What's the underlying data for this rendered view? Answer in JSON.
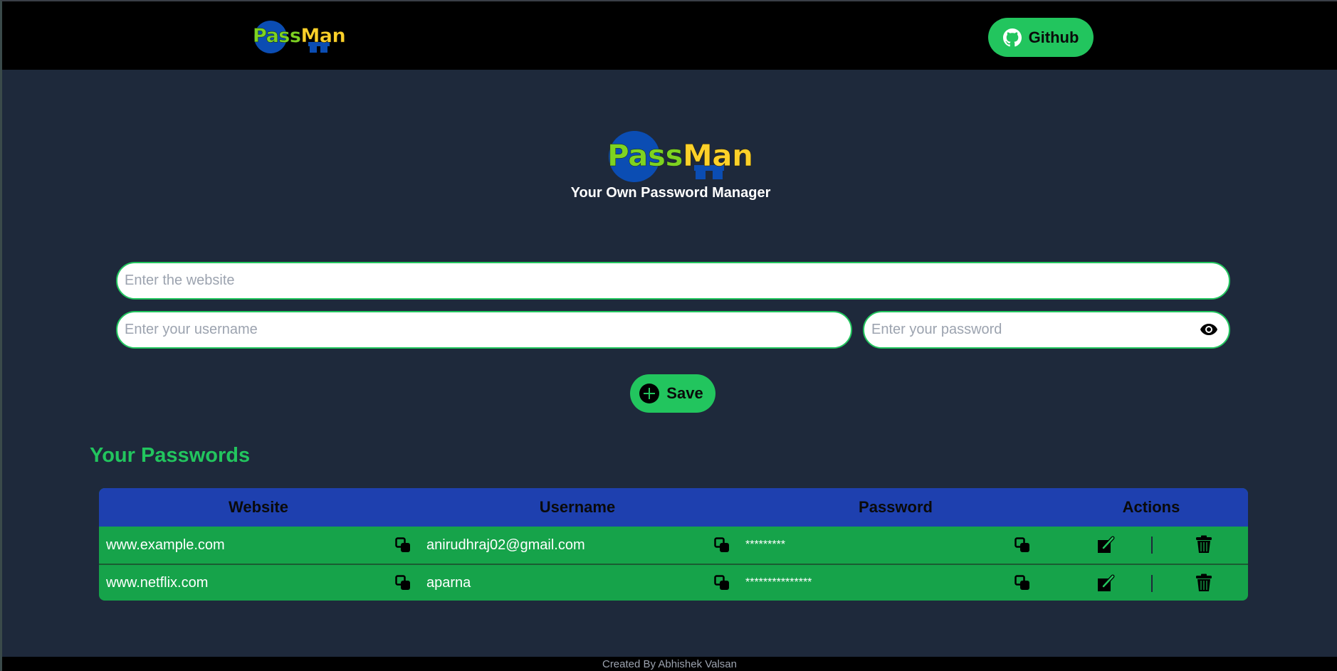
{
  "nav": {
    "logo": {
      "part1": "Pass",
      "part2": "Man"
    },
    "github_label": "Github",
    "github_icon": "github-icon"
  },
  "hero": {
    "logo": {
      "part1": "Pass",
      "part2": "Man"
    },
    "subtitle": "Your Own Password Manager"
  },
  "form": {
    "website": {
      "value": "",
      "placeholder": "Enter the website"
    },
    "username": {
      "value": "",
      "placeholder": "Enter your username"
    },
    "password": {
      "value": "",
      "placeholder": "Enter your password",
      "toggle_icon": "eye-icon"
    },
    "save_label": "Save",
    "save_icon": "plus-circle-icon"
  },
  "passwords": {
    "title": "Your Passwords",
    "columns": [
      "Website",
      "Username",
      "Password",
      "Actions"
    ],
    "rows": [
      {
        "website": "www.example.com",
        "username": "anirudhraj02@gmail.com",
        "password": "*********"
      },
      {
        "website": "www.netflix.com",
        "username": "aparna",
        "password": "***************"
      }
    ],
    "row_icons": {
      "copy": "copy-icon",
      "edit": "edit-icon",
      "delete": "trash-icon"
    }
  },
  "colors": {
    "accent": "#22c55e",
    "table_header": "#1e40af",
    "table_row": "#16a34a",
    "background": "#1e293b",
    "logo_pass": "#7ed321",
    "logo_man": "#fcd12a",
    "logo_mark": "#0b4db3"
  },
  "footer": {
    "text": "Created By Abhishek Valsan"
  }
}
